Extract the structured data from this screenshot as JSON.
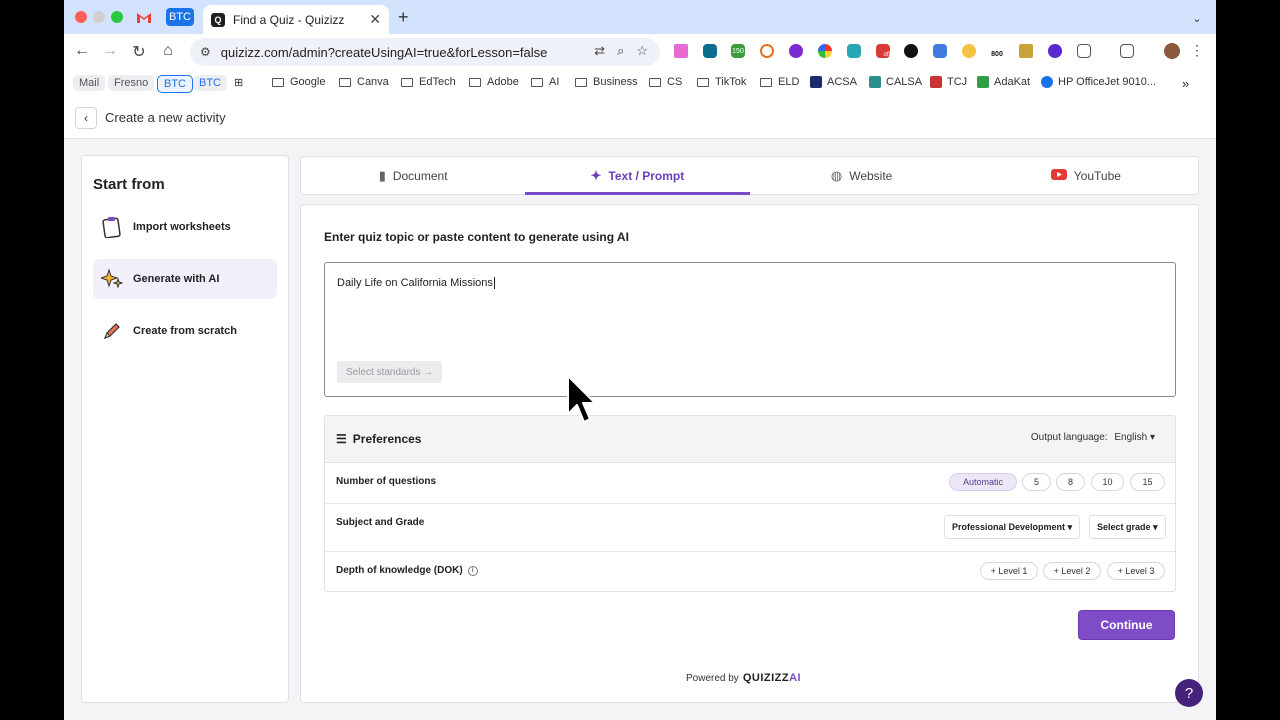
{
  "browser": {
    "pins": [
      "BTC"
    ],
    "tab": {
      "title": "Find a Quiz - Quizizz",
      "favicon_letter": "Q"
    },
    "url": "quizizz.com/admin?createUsingAI=true&forLesson=false",
    "bookmarks": {
      "pills": [
        "Mail",
        "Fresno",
        "BTC",
        "BTC"
      ],
      "items": [
        "Google",
        "Canva",
        "EdTech",
        "Adobe",
        "AI",
        "Business",
        "CS",
        "TikTok",
        "ELD",
        "ACSA",
        "CALSA",
        "TCJ",
        "AdaKat",
        "HP OfficeJet 9010..."
      ],
      "overflow": "»"
    },
    "ext_badges": [
      "150",
      "off",
      "800"
    ]
  },
  "page": {
    "header_title": "Create a new activity",
    "left_panel": {
      "title": "Start from",
      "items": [
        {
          "label": "Import worksheets"
        },
        {
          "label": "Generate with AI"
        },
        {
          "label": "Create from scratch"
        }
      ]
    },
    "source_tabs": [
      {
        "label": "Document",
        "icon": "document-icon"
      },
      {
        "label": "Text / Prompt",
        "icon": "sparkle-icon"
      },
      {
        "label": "Website",
        "icon": "globe-icon"
      },
      {
        "label": "YouTube",
        "icon": "youtube-icon"
      }
    ],
    "prompt": {
      "label": "Enter quiz topic or paste content to generate using AI",
      "value": "Daily Life on California Missions",
      "standards_button": "Select standards →"
    },
    "preferences": {
      "title": "Preferences",
      "output_language_label": "Output language:",
      "output_language": "English",
      "num_questions": {
        "label": "Number of questions",
        "options": [
          "Automatic",
          "5",
          "8",
          "10",
          "15"
        ],
        "selected": "Automatic"
      },
      "subject_grade": {
        "label": "Subject and Grade",
        "subject": "Professional Development",
        "grade": "Select grade"
      },
      "dok": {
        "label": "Depth of knowledge (DOK)",
        "levels": [
          "+ Level 1",
          "+ Level 2",
          "+ Level 3"
        ]
      }
    },
    "continue_label": "Continue",
    "powered_by": "Powered by",
    "brand": "QUIZIZZ",
    "brand_ai": "AI",
    "help": "?"
  }
}
